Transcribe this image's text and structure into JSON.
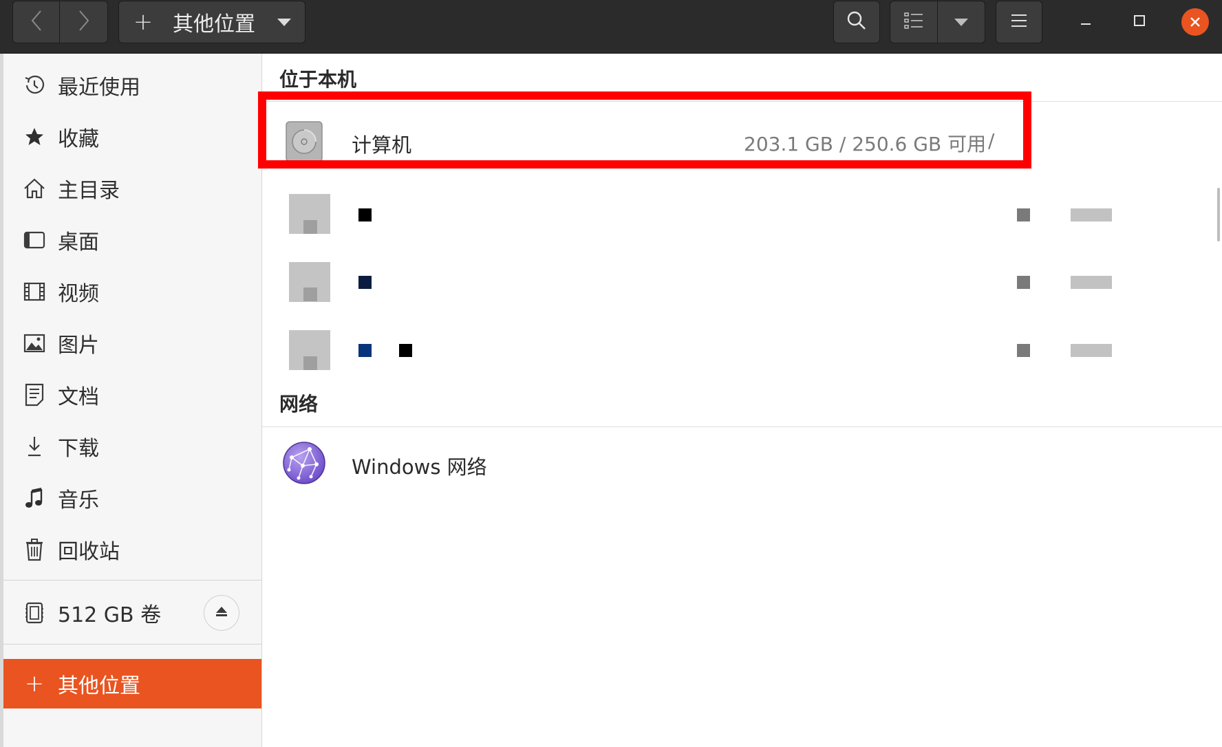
{
  "header": {
    "back_label": "back",
    "forward_label": "forward",
    "path_plus": "+",
    "path_title": "其他位置",
    "icons": {
      "back": "chevron-left-icon",
      "forward": "chevron-right-icon",
      "search": "search-icon",
      "view": "list-view-icon",
      "view_menu": "caret-down-icon",
      "menu": "hamburger-menu-icon",
      "minimize": "minimize-icon",
      "maximize": "maximize-icon",
      "close": "close-icon"
    }
  },
  "sidebar": {
    "items": [
      {
        "label": "最近使用",
        "icon": "clock-icon"
      },
      {
        "label": "收藏",
        "icon": "star-icon"
      },
      {
        "label": "主目录",
        "icon": "home-icon"
      },
      {
        "label": "桌面",
        "icon": "desktop-icon"
      },
      {
        "label": "视频",
        "icon": "film-icon"
      },
      {
        "label": "图片",
        "icon": "image-icon"
      },
      {
        "label": "文档",
        "icon": "document-icon"
      },
      {
        "label": "下载",
        "icon": "download-icon"
      },
      {
        "label": "音乐",
        "icon": "music-icon"
      },
      {
        "label": "回收站",
        "icon": "trash-icon"
      }
    ],
    "volume": {
      "label": "512 GB 卷",
      "icon": "drive-icon",
      "eject_icon": "eject-icon"
    },
    "other_locations": {
      "label": "其他位置",
      "plus": "+"
    }
  },
  "main": {
    "local_title": "位于本机",
    "computer": {
      "label": "计算机",
      "size": "203.1 GB / 250.6 GB 可用",
      "mount": "/",
      "icon": "harddisk-icon"
    },
    "network_title": "网络",
    "windows_network": {
      "label": "Windows 网络",
      "icon": "network-globe-icon"
    }
  },
  "colors": {
    "accent": "#e95420",
    "highlight": "#ff0000",
    "header_bg": "#2b2b2b"
  }
}
